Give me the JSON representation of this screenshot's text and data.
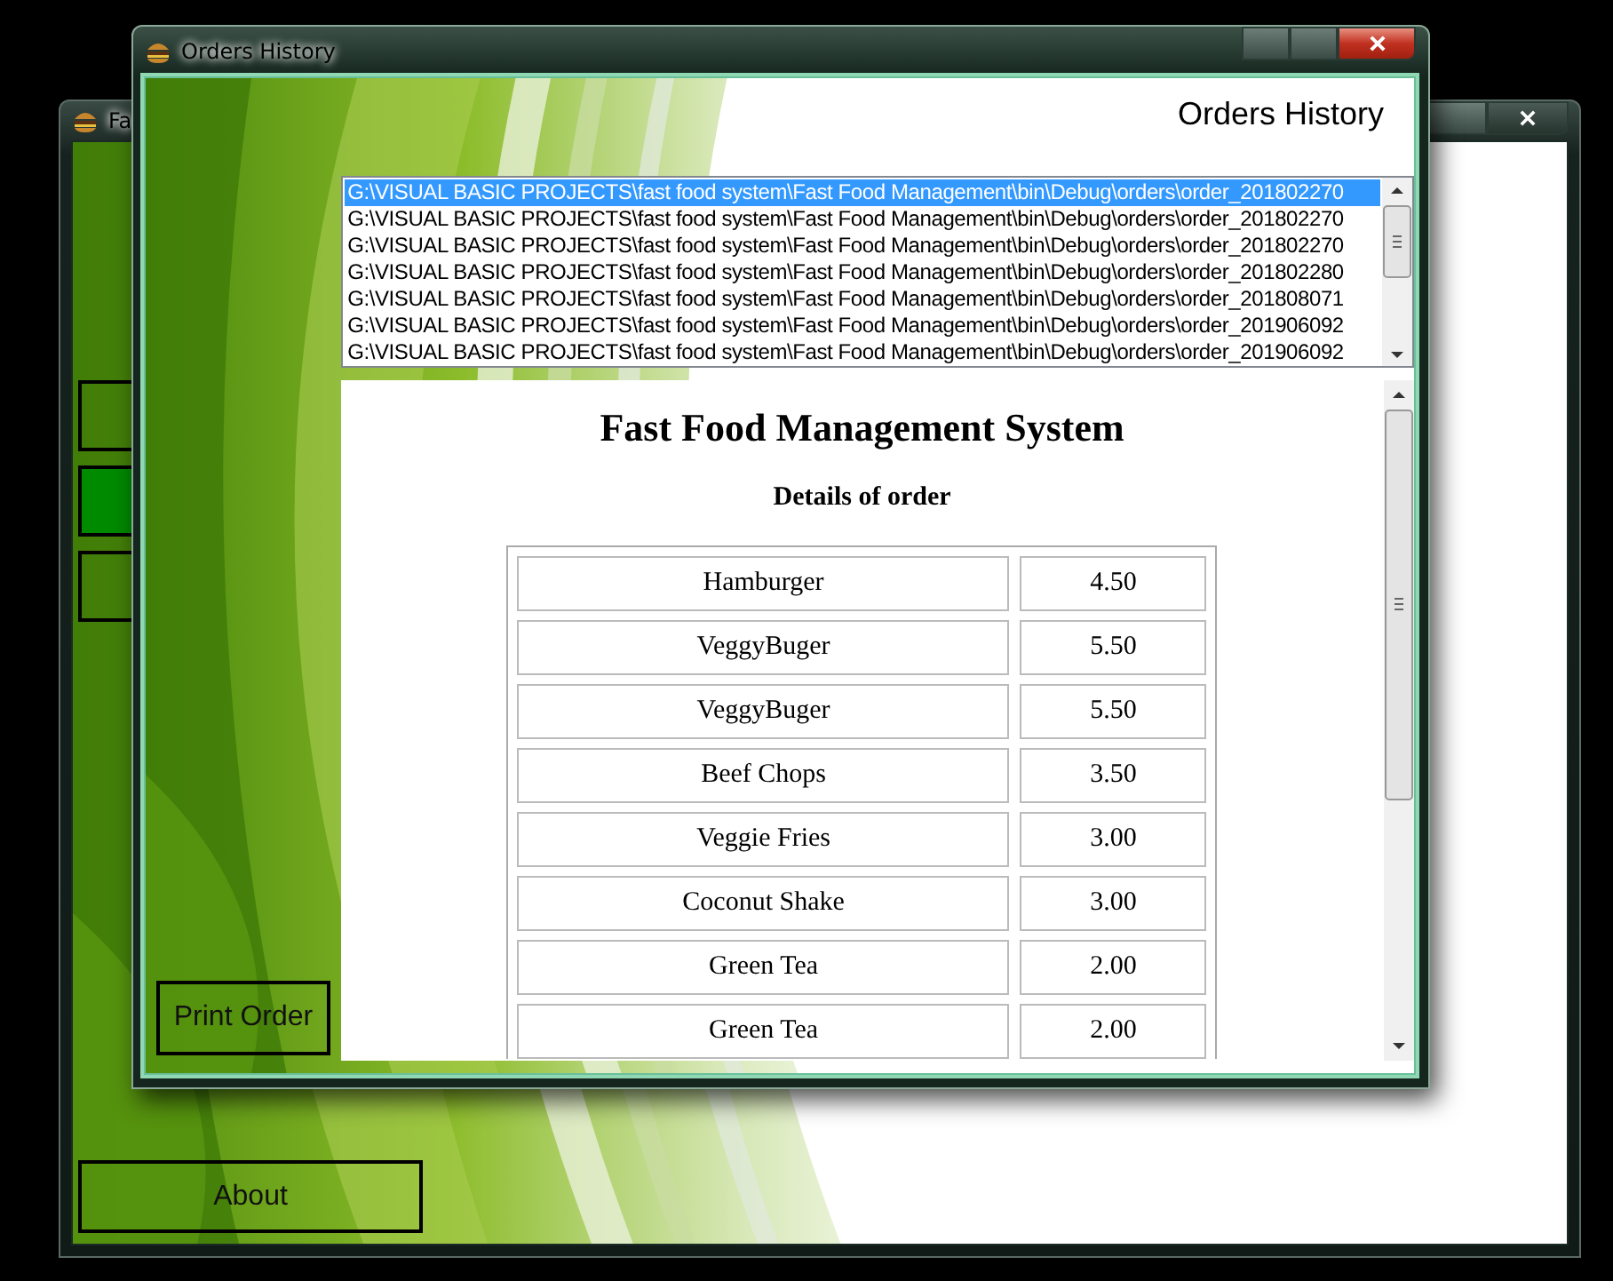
{
  "back_window": {
    "title": "Fa",
    "menu_buttons": [
      {
        "selected": false
      },
      {
        "selected": true
      },
      {
        "selected": false
      }
    ],
    "about_button": "About"
  },
  "window": {
    "title": "Orders History",
    "heading": "Orders History",
    "files": [
      {
        "path": "G:\\VISUAL BASIC PROJECTS\\fast food system\\Fast Food Management\\bin\\Debug\\orders\\order_201802270",
        "selected": true
      },
      {
        "path": "G:\\VISUAL BASIC PROJECTS\\fast food system\\Fast Food Management\\bin\\Debug\\orders\\order_201802270",
        "selected": false
      },
      {
        "path": "G:\\VISUAL BASIC PROJECTS\\fast food system\\Fast Food Management\\bin\\Debug\\orders\\order_201802270",
        "selected": false
      },
      {
        "path": "G:\\VISUAL BASIC PROJECTS\\fast food system\\Fast Food Management\\bin\\Debug\\orders\\order_201802280",
        "selected": false
      },
      {
        "path": "G:\\VISUAL BASIC PROJECTS\\fast food system\\Fast Food Management\\bin\\Debug\\orders\\order_201808071",
        "selected": false
      },
      {
        "path": "G:\\VISUAL BASIC PROJECTS\\fast food system\\Fast Food Management\\bin\\Debug\\orders\\order_201906092",
        "selected": false
      },
      {
        "path": "G:\\VISUAL BASIC PROJECTS\\fast food system\\Fast Food Management\\bin\\Debug\\orders\\order_201906092",
        "selected": false
      }
    ],
    "document": {
      "title": "Fast Food Management System",
      "subtitle": "Details of order",
      "rows": [
        {
          "item": "Hamburger",
          "price": "4.50"
        },
        {
          "item": "VeggyBuger",
          "price": "5.50"
        },
        {
          "item": "VeggyBuger",
          "price": "5.50"
        },
        {
          "item": "Beef Chops",
          "price": "3.50"
        },
        {
          "item": "Veggie Fries",
          "price": "3.00"
        },
        {
          "item": "Coconut Shake",
          "price": "3.00"
        },
        {
          "item": "Green Tea",
          "price": "2.00"
        },
        {
          "item": "Green Tea",
          "price": "2.00"
        }
      ]
    },
    "print_button": "Print Order"
  }
}
